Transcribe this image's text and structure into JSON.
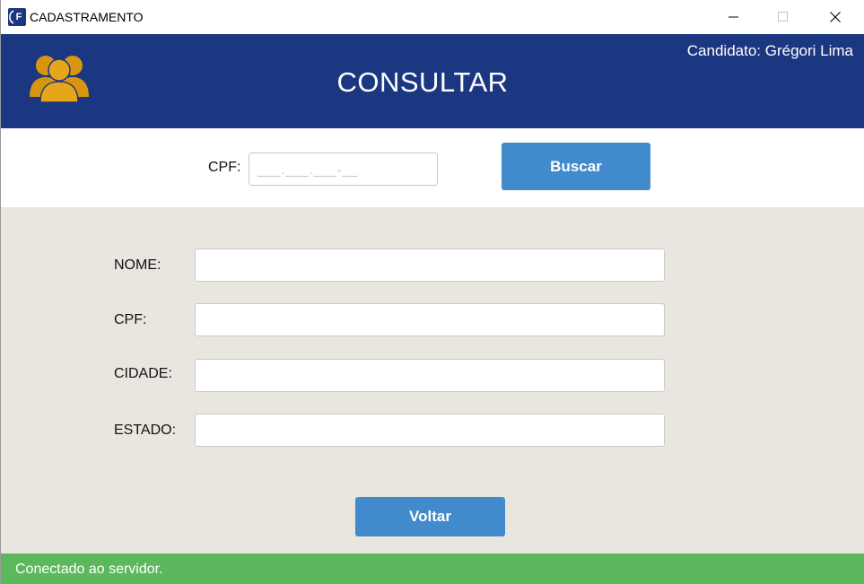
{
  "window": {
    "title": "CADASTRAMENTO",
    "app_icon_letter": "F"
  },
  "header": {
    "title": "CONSULTAR",
    "candidate": "Candidato: Grégori Lima",
    "icon": "users-icon",
    "background": "#1c3782",
    "icon_color": "#e0a11a"
  },
  "search": {
    "label": "CPF:",
    "placeholder": "___.___.___-__",
    "button_label": "Buscar"
  },
  "form": {
    "fields": [
      {
        "label": "NOME:",
        "value": ""
      },
      {
        "label": "CPF:",
        "value": ""
      },
      {
        "label": "CIDADE:",
        "value": ""
      },
      {
        "label": "ESTADO:",
        "value": ""
      }
    ],
    "back_label": "Voltar",
    "background": "#e8e6de"
  },
  "status": {
    "text": "Conectado ao servidor.",
    "color": "#5cb85c"
  },
  "colors": {
    "button": "#418bcc"
  }
}
